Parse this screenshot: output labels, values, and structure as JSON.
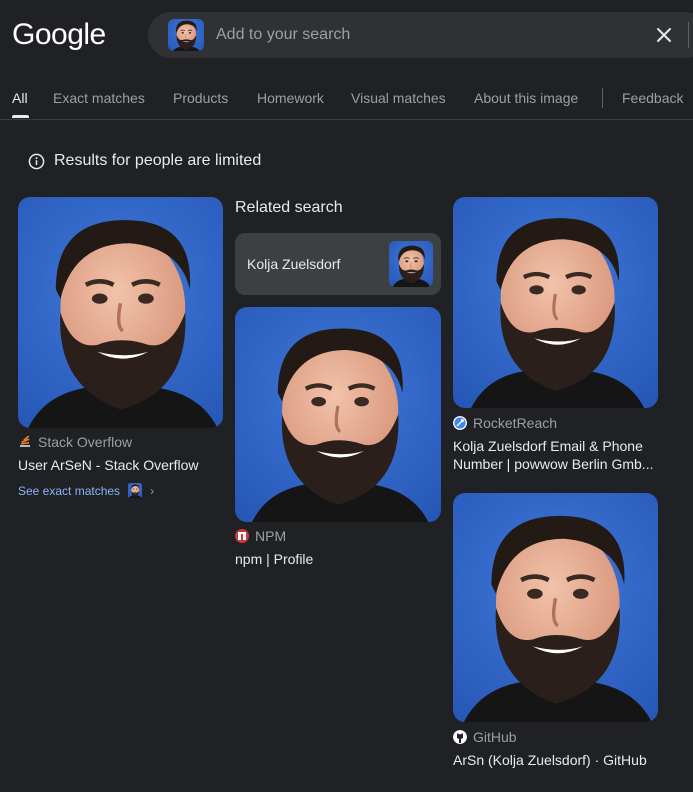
{
  "header": {
    "logo": "Google",
    "search": {
      "placeholder": "Add to your search",
      "thumb_icon": "face-thumbnail"
    }
  },
  "tabs": [
    {
      "label": "All",
      "active": true
    },
    {
      "label": "Exact matches"
    },
    {
      "label": "Products"
    },
    {
      "label": "Homework"
    },
    {
      "label": "Visual matches"
    },
    {
      "label": "About this image"
    },
    {
      "label": "Feedback"
    }
  ],
  "notice": {
    "text": "Results for people are limited",
    "icon": "info-icon"
  },
  "related": {
    "label": "Related search",
    "chip": "Kolja Zuelsdorf"
  },
  "results": [
    {
      "source": "Stack Overflow",
      "title": "User ArSeN - Stack Overflow",
      "exact": "See exact matches",
      "src_color": "#f48024"
    },
    {
      "source": "NPM",
      "title": "npm | Profile",
      "src_color": "#cb3837"
    },
    {
      "source": "RocketReach",
      "title": "Kolja Zuelsdorf Email & Phone Number | powwow Berlin Gmb...",
      "src_color": "#4285f4"
    },
    {
      "source": "GitHub",
      "title": "ArSn (Kolja Zuelsdorf) · GitHub",
      "src_color": "#ffffff"
    }
  ],
  "colors": {
    "background": "#202124",
    "accent": "#8ab4f8",
    "photo_bg": "#2f63c8"
  }
}
